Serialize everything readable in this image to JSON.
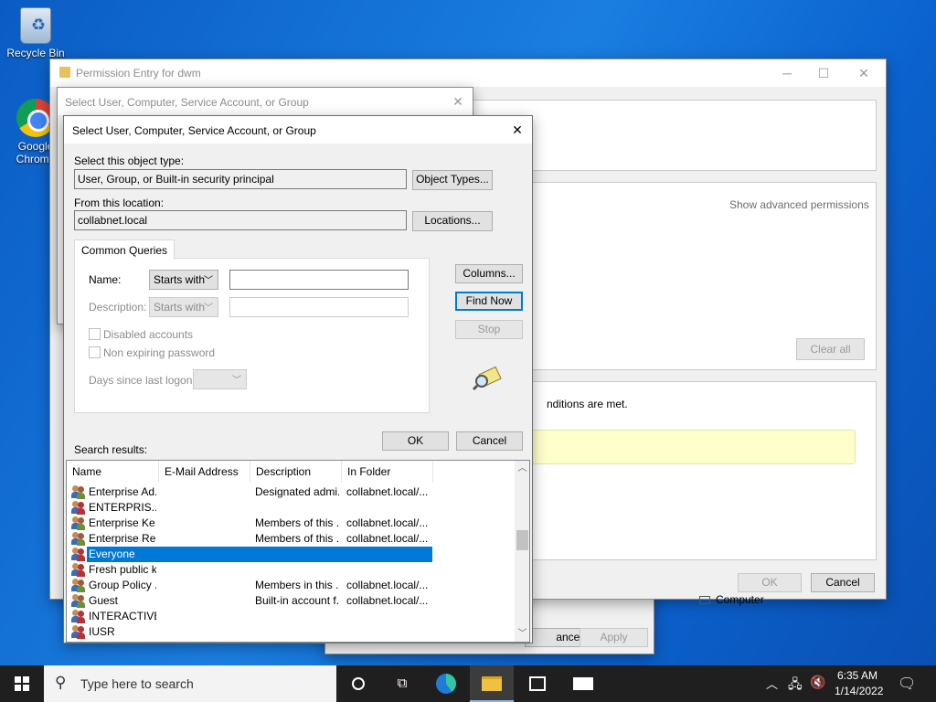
{
  "desktop": {
    "icons": [
      {
        "label": "Recycle Bin",
        "icon": "recycle-bin-icon"
      },
      {
        "label": "Google Chrome",
        "icon": "chrome-icon"
      }
    ]
  },
  "permission_window": {
    "title": "Permission Entry for dwm",
    "show_advanced": "Show advanced permissions",
    "clear_all": "Clear all",
    "conditions_text": "nditions are met.",
    "computer_label": "Computer",
    "ok": "OK",
    "cancel": "Cancel"
  },
  "behind_window": {
    "cancel_partial": "ancel",
    "apply": "Apply"
  },
  "select_dialog_back": {
    "title": "Select User, Computer, Service Account, or Group"
  },
  "select_dialog": {
    "title": "Select User, Computer, Service Account, or Group",
    "object_type_label": "Select this object type:",
    "object_type_value": "User, Group, or Built-in security principal",
    "object_types_button": "Object Types...",
    "location_label": "From this location:",
    "location_value": "collabnet.local",
    "locations_button": "Locations...",
    "tab_label": "Common Queries",
    "name_label": "Name:",
    "name_mode": "Starts with",
    "description_label": "Description:",
    "description_mode": "Starts with",
    "disabled_accounts": "Disabled accounts",
    "non_expiring": "Non expiring password",
    "days_since_logon": "Days since last logon:",
    "columns_button": "Columns...",
    "find_now_button": "Find Now",
    "stop_button": "Stop",
    "ok_button": "OK",
    "cancel_button": "Cancel",
    "search_results_label": "Search results:",
    "columns": [
      "Name",
      "E-Mail Address",
      "Description",
      "In Folder"
    ],
    "rows": [
      {
        "name": "Enterprise Ad...",
        "email": "",
        "description": "Designated admi...",
        "folder": "collabnet.local/...",
        "kind": "group"
      },
      {
        "name": "ENTERPRIS...",
        "email": "",
        "description": "",
        "folder": "",
        "kind": "special"
      },
      {
        "name": "Enterprise Ke...",
        "email": "",
        "description": "Members of this ...",
        "folder": "collabnet.local/...",
        "kind": "group"
      },
      {
        "name": "Enterprise Re...",
        "email": "",
        "description": "Members of this ...",
        "folder": "collabnet.local/...",
        "kind": "group"
      },
      {
        "name": "Everyone",
        "email": "",
        "description": "",
        "folder": "",
        "kind": "special",
        "selected": true
      },
      {
        "name": "Fresh public k...",
        "email": "",
        "description": "",
        "folder": "",
        "kind": "special"
      },
      {
        "name": "Group Policy ...",
        "email": "",
        "description": "Members in this ...",
        "folder": "collabnet.local/...",
        "kind": "group"
      },
      {
        "name": "Guest",
        "email": "",
        "description": "Built-in account f...",
        "folder": "collabnet.local/...",
        "kind": "user"
      },
      {
        "name": "INTERACTIVE",
        "email": "",
        "description": "",
        "folder": "",
        "kind": "special"
      },
      {
        "name": "IUSR",
        "email": "",
        "description": "",
        "folder": "",
        "kind": "special"
      }
    ]
  },
  "taskbar": {
    "search_placeholder": "Type here to search",
    "time": "6:35 AM",
    "date": "1/14/2022"
  }
}
